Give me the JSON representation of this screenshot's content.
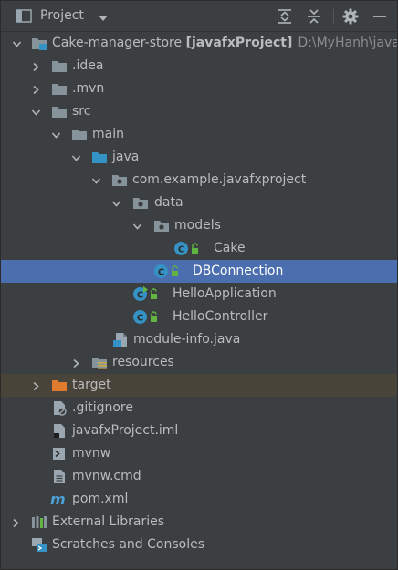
{
  "header": {
    "title": "Project",
    "icons": [
      "project-view-icon",
      "chevron-down-icon",
      "expand-all-icon",
      "collapse-all-icon",
      "gear-icon",
      "minimize-icon"
    ]
  },
  "colors": {
    "background": "#3c3f41",
    "selection": "#4b6eaf",
    "excluded_row": "#49443a",
    "folder": "#87939a",
    "class_icon": "#3592c4",
    "target_folder": "#e07a2f",
    "text": "#bbbbbb",
    "path_text": "#8c8c8c"
  },
  "tree": {
    "root_name": "Cake-manager-store",
    "root_module": "[javafxProject]",
    "root_path": "D:\\MyHanh\\java\\Ca",
    "idea": ".idea",
    "mvn": ".mvn",
    "src": "src",
    "main": "main",
    "java": "java",
    "package": "com.example.javafxproject",
    "data": "data",
    "models": "models",
    "cake": "Cake",
    "dbconnection": "DBConnection",
    "hello_application": "HelloApplication",
    "hello_controller": "HelloController",
    "module_info": "module-info.java",
    "resources": "resources",
    "target": "target",
    "gitignore": ".gitignore",
    "iml": "javafxProject.iml",
    "mvnw": "mvnw",
    "mvnw_cmd": "mvnw.cmd",
    "pom": "pom.xml",
    "external_libraries": "External Libraries",
    "scratches": "Scratches and Consoles"
  }
}
